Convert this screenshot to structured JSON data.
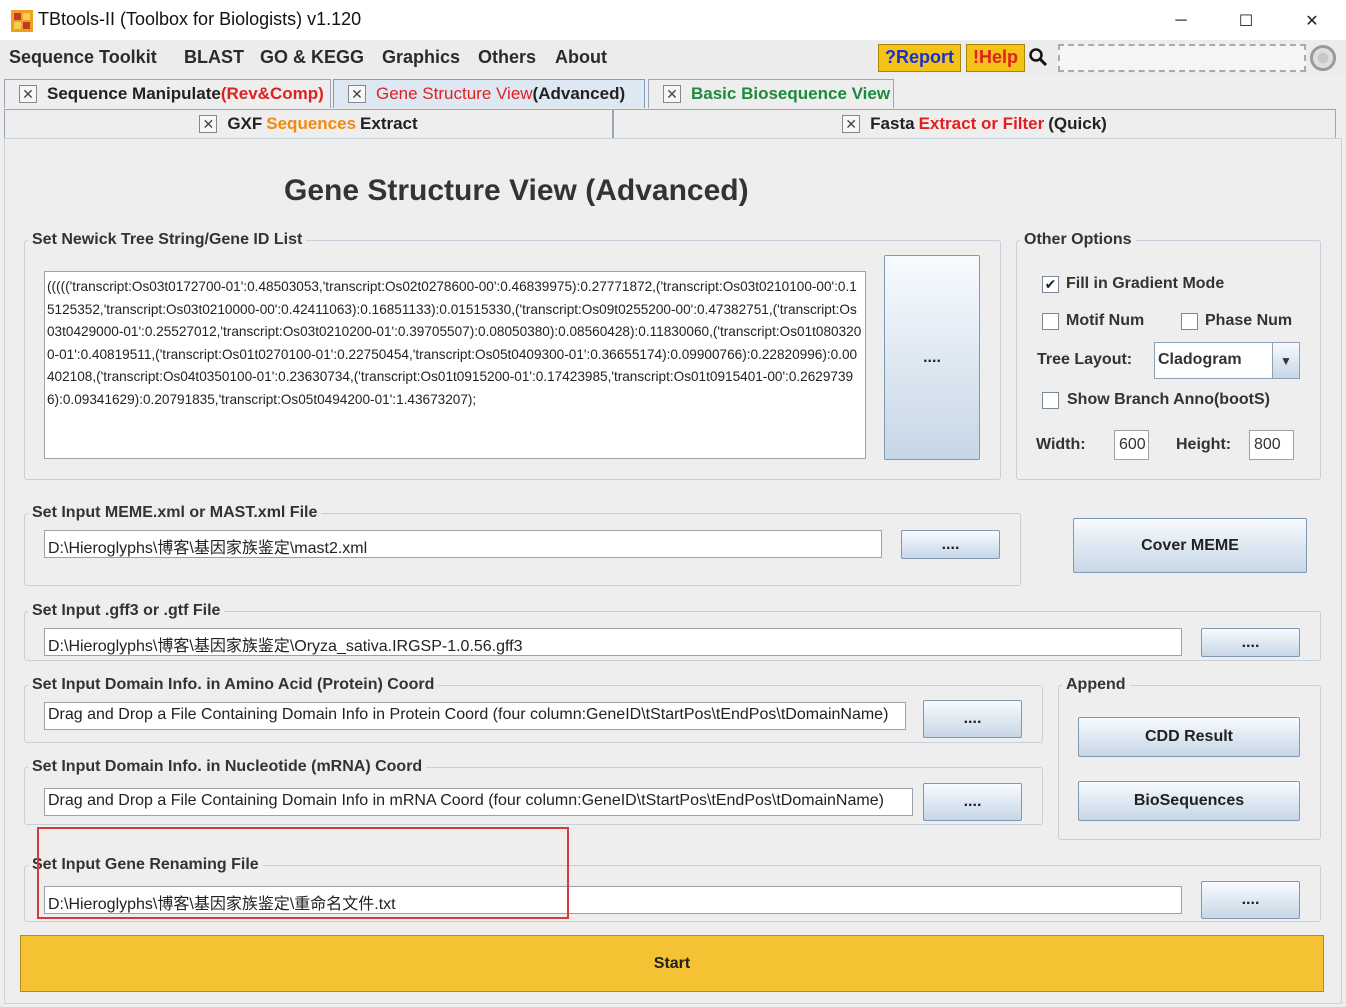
{
  "window": {
    "title": "TBtools-II (Toolbox for Biologists) v1.120",
    "minimize": "─",
    "maximize": "☐",
    "close": "✕"
  },
  "menu": {
    "items": [
      "Sequence Toolkit",
      "BLAST",
      "GO & KEGG",
      "Graphics",
      "Others",
      "About"
    ],
    "report_label": "?Report",
    "help_label": "!Help",
    "search_icon": "🔍"
  },
  "tabs": {
    "row1": [
      {
        "segments": [
          "Sequence Manipulate ",
          "(Rev&Comp)"
        ]
      },
      {
        "segments": [
          "Gene Structure View",
          " (Advanced)"
        ],
        "active": true
      },
      {
        "segments": [
          "Basic Biosequence View"
        ]
      }
    ],
    "row2": [
      {
        "segments": [
          "GXF ",
          "Sequences",
          " Extract"
        ]
      },
      {
        "segments": [
          "Fasta ",
          "Extract or Filter",
          " (Quick)"
        ]
      }
    ],
    "close_glyph": "✕"
  },
  "page": {
    "title": "Gene Structure View (Advanced)"
  },
  "newick": {
    "label": "Set Newick Tree String/Gene ID List",
    "value": "((((('transcript:Os03t0172700-01':0.48503053,'transcript:Os02t0278600-00':0.46839975):0.27771872,('transcript:Os03t0210100-00':0.15125352,'transcript:Os03t0210000-00':0.42411063):0.16851133):0.01515330,('transcript:Os09t0255200-00':0.47382751,('transcript:Os03t0429000-01':0.25527012,'transcript:Os03t0210200-01':0.39705507):0.08050380):0.08560428):0.11830060,('transcript:Os01t0803200-01':0.40819511,('transcript:Os01t0270100-01':0.22750454,'transcript:Os05t0409300-01':0.36655174):0.09900766):0.22820996):0.00402108,('transcript:Os04t0350100-01':0.23630734,('transcript:Os01t0915200-01':0.17423985,'transcript:Os01t0915401-00':0.26297396):0.09341629):0.20791835,'transcript:Os05t0494200-01':1.43673207);",
    "browse_label": "...."
  },
  "other_options": {
    "label": "Other Options",
    "fill_gradient": {
      "label": "Fill in Gradient Mode",
      "checked": true,
      "mark": "✔"
    },
    "motif_num": {
      "label": "Motif Num",
      "checked": false
    },
    "phase_num": {
      "label": "Phase Num",
      "checked": false
    },
    "tree_layout_label": "Tree Layout:",
    "tree_layout_value": "Cladogram",
    "tree_layout_arrow": "▼",
    "show_branch": {
      "label": "Show Branch Anno(bootS)",
      "checked": false
    },
    "width_label": "Width:",
    "width_value": "600",
    "height_label": "Height:",
    "height_value": "800"
  },
  "meme": {
    "label": "Set Input MEME.xml or MAST.xml File",
    "value": "D:\\Hieroglyphs\\博客\\基因家族鉴定\\mast2.xml",
    "browse_label": "....",
    "cover_label": "Cover MEME"
  },
  "gff": {
    "label": "Set Input .gff3 or .gtf File",
    "value": "D:\\Hieroglyphs\\博客\\基因家族鉴定\\Oryza_sativa.IRGSP-1.0.56.gff3",
    "browse_label": "...."
  },
  "protein_domain": {
    "label": "Set Input Domain Info. in Amino Acid (Protein) Coord",
    "value": "Drag and Drop a File Containing Domain Info in Protein Coord (four column:GeneID\\tStartPos\\tEndPos\\tDomainName)",
    "browse_label": "...."
  },
  "mrna_domain": {
    "label": "Set Input Domain Info. in Nucleotide (mRNA) Coord",
    "value": "Drag and Drop a File Containing Domain Info in mRNA Coord (four column:GeneID\\tStartPos\\tEndPos\\tDomainName)",
    "browse_label": "...."
  },
  "append": {
    "label": "Append",
    "cdd_label": "CDD Result",
    "bioseq_label": "BioSequences"
  },
  "rename": {
    "label": "Set Input Gene Renaming File",
    "value": "D:\\Hieroglyphs\\博客\\基因家族鉴定\\重命名文件.txt",
    "browse_label": "...."
  },
  "start": {
    "label": "Start"
  },
  "colors": {
    "accent_yellow": "#f5c234",
    "annotation_red": "#d63a3a",
    "tab_red": "#e02020",
    "tab_orange": "#ef8a12",
    "tab_green": "#1d8a3c"
  }
}
